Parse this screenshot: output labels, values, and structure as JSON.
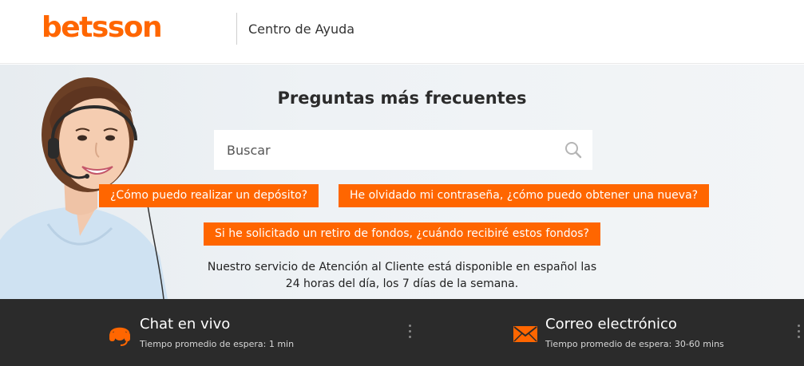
{
  "header": {
    "logo_text": "betsson",
    "help_center": "Centro de Ayuda"
  },
  "hero": {
    "title": "Preguntas más frecuentes",
    "search": {
      "placeholder": "Buscar",
      "value": "",
      "icon": "search-icon"
    },
    "faqs": [
      "¿Cómo puedo realizar un depósito?",
      "He olvidado mi contraseña, ¿cómo puedo obtener una nueva?",
      "Si he solicitado un retiro de fondos, ¿cuándo recibiré estos fondos?"
    ],
    "availability_line1": "Nuestro servicio de Atención al Cliente está disponible en español las",
    "availability_line2": "24 horas del día, los 7 días de la semana."
  },
  "footer": {
    "chat": {
      "title": "Chat en vivo",
      "subtitle": "Tiempo promedio de espera: 1 min",
      "icon": "headset-icon"
    },
    "email": {
      "title": "Correo electrónico",
      "subtitle": "Tiempo promedio de espera: 30-60 mins",
      "icon": "envelope-icon"
    }
  },
  "colors": {
    "brand": "#ff6600",
    "footer_bg": "#2b2b2b",
    "hero_bg": "#eef2f5"
  }
}
